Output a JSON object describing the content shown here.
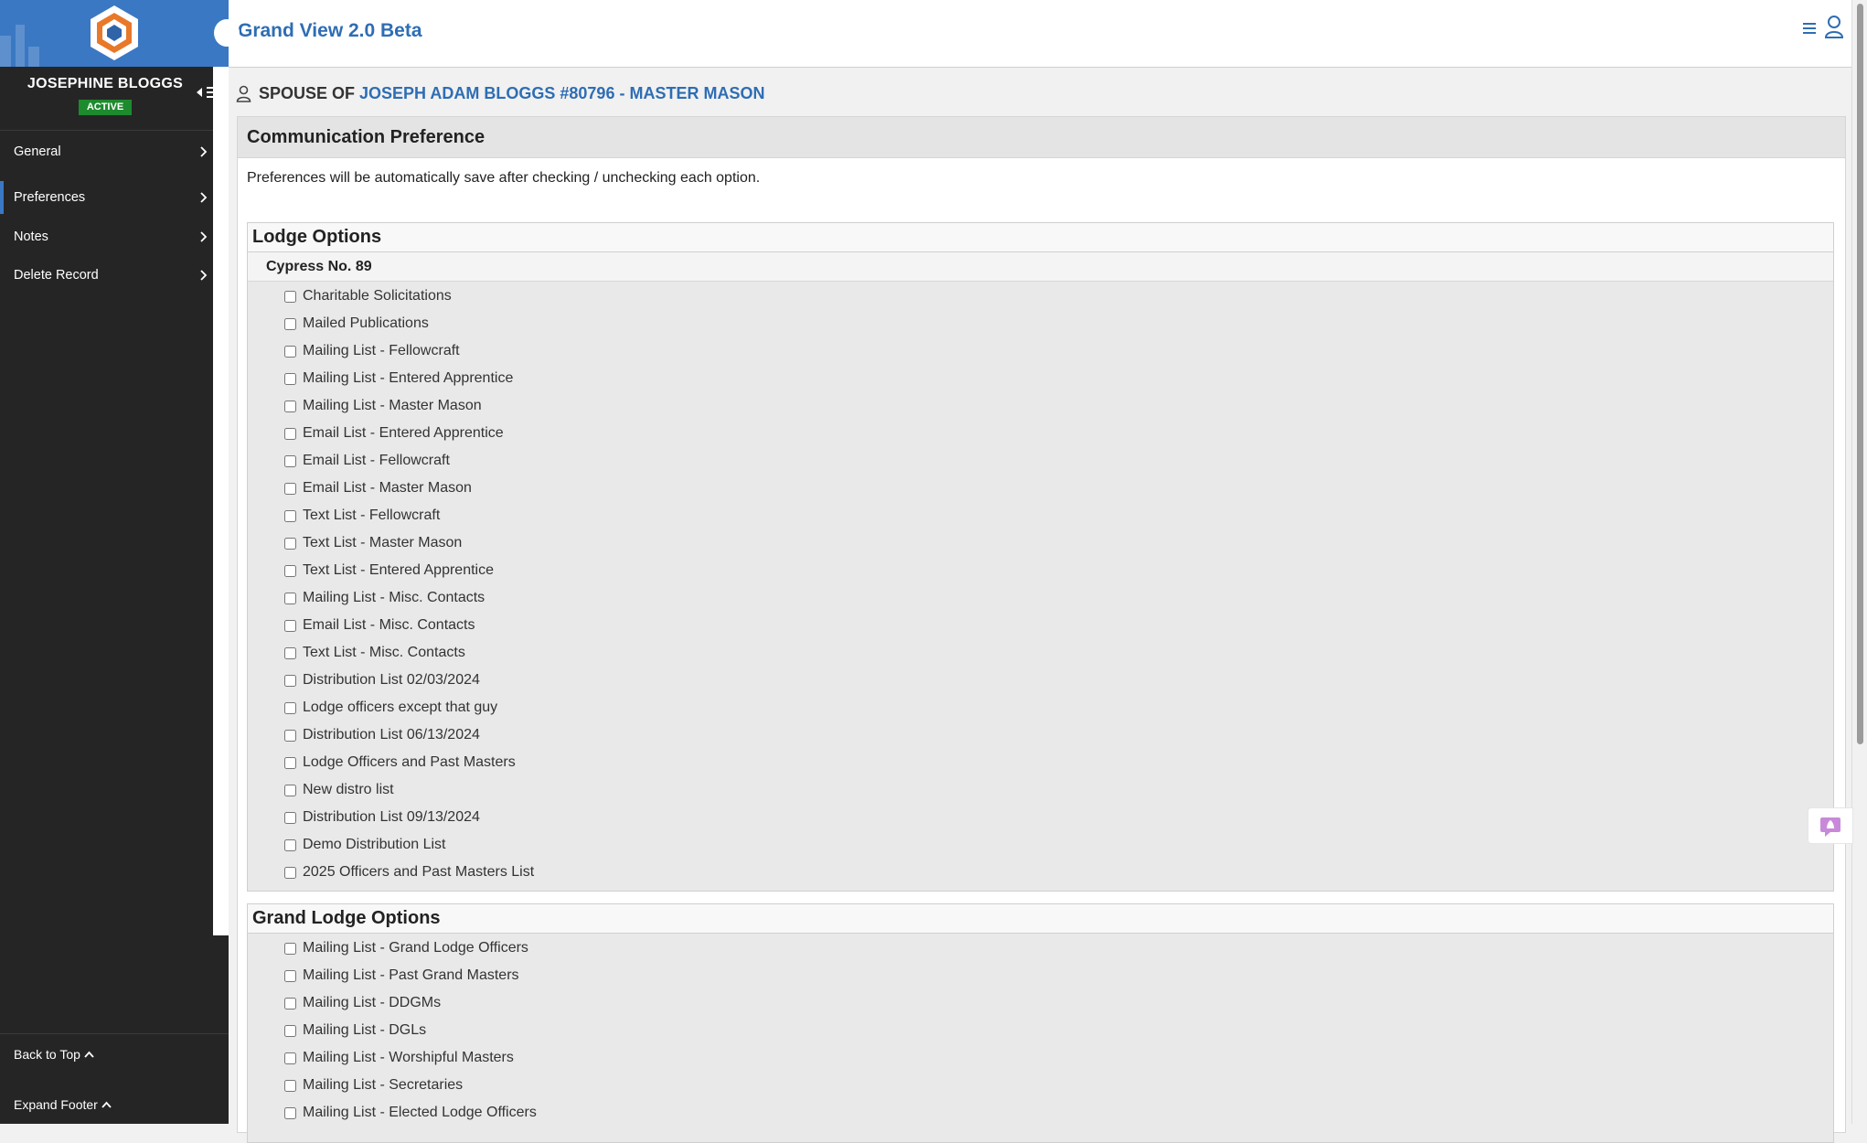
{
  "sidebar": {
    "user_name": "JOSEPHINE BLOGGS",
    "status": "ACTIVE",
    "nav": [
      {
        "label": "General"
      },
      {
        "label": "Preferences"
      },
      {
        "label": "Notes"
      },
      {
        "label": "Delete Record"
      }
    ],
    "back_to_top": "Back to Top",
    "expand_footer": "Expand Footer",
    "accent_color": "#3a78c3"
  },
  "header": {
    "title": "Grand View 2.0 Beta"
  },
  "breadcrumb": {
    "prefix": "SPOUSE OF",
    "link": "JOSEPH ADAM BLOGGS #80796 - MASTER MASON"
  },
  "panel": {
    "title": "Communication Preference",
    "description": "Preferences will be automatically save after checking / unchecking each option.",
    "lodge_options": {
      "heading": "Lodge Options",
      "lodge_name": "Cypress No. 89",
      "items": [
        "Charitable Solicitations",
        "Mailed Publications",
        "Mailing List - Fellowcraft",
        "Mailing List - Entered Apprentice",
        "Mailing List - Master Mason",
        "Email List - Entered Apprentice",
        "Email List - Fellowcraft",
        "Email List - Master Mason",
        "Text List - Fellowcraft",
        "Text List - Master Mason",
        "Text List - Entered Apprentice",
        "Mailing List - Misc. Contacts",
        "Email List - Misc. Contacts",
        "Text List - Misc. Contacts",
        "Distribution List 02/03/2024",
        "Lodge officers except that guy",
        "Distribution List 06/13/2024",
        "Lodge Officers and Past Masters",
        "New distro list",
        "Distribution List 09/13/2024",
        "Demo Distribution List",
        "2025 Officers and Past Masters List"
      ]
    },
    "grand_lodge_options": {
      "heading": "Grand Lodge Options",
      "items": [
        "Mailing List - Grand Lodge Officers",
        "Mailing List - Past Grand Masters",
        "Mailing List - DDGMs",
        "Mailing List - DGLs",
        "Mailing List - Worshipful Masters",
        "Mailing List - Secretaries",
        "Mailing List - Elected Lodge Officers"
      ]
    }
  }
}
